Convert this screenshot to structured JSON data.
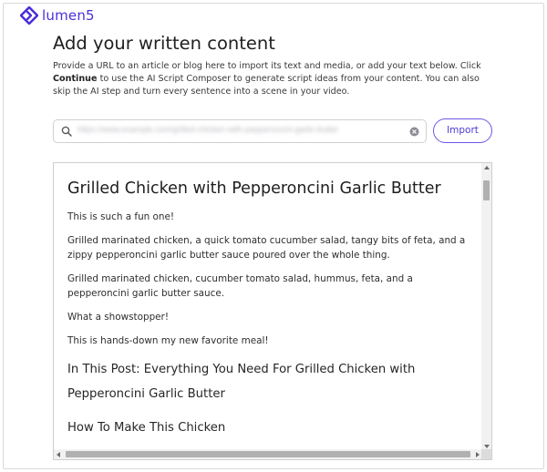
{
  "brand": {
    "name": "lumen5",
    "accent_color": "#4b2fd9"
  },
  "page": {
    "title": "Add your written content",
    "description_before": "Provide a URL to an article or blog here to import its text and media, or add your text below. Click ",
    "description_bold": "Continue",
    "description_after": " to use the AI Script Composer to generate script ideas from your content. You can also skip the AI step and turn every sentence into a scene in your video."
  },
  "url_input": {
    "value": "https://www.example.com/grilled-chicken-with-pepperoncini-garlic-butter",
    "search_icon": "search-icon",
    "clear_icon": "clear-circle-icon"
  },
  "import_button": {
    "label": "Import"
  },
  "content": {
    "heading": "Grilled Chicken with Pepperoncini Garlic Butter",
    "paragraphs": [
      "This is such a fun one!",
      "Grilled marinated chicken, a quick tomato cucumber salad, tangy bits of feta, and a zippy pepperoncini garlic butter sauce poured over the whole thing.",
      "Grilled marinated chicken, cucumber tomato salad, hummus, feta, and a pepperoncini garlic butter sauce.",
      "What a showstopper!",
      "This is hands-down my new favorite meal!"
    ],
    "subheadings": [
      "In This Post: Everything You Need For Grilled Chicken with Pepperoncini Garlic Butter",
      "How To Make This Chicken"
    ]
  }
}
